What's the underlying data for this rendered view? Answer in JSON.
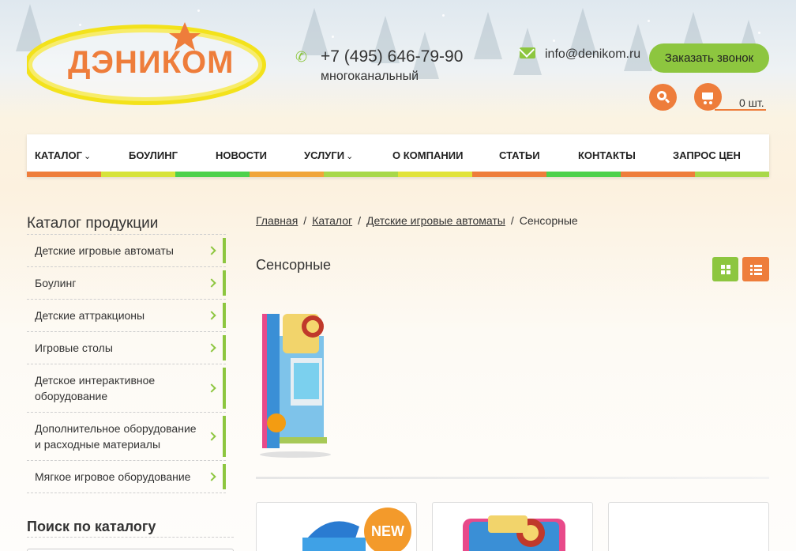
{
  "header": {
    "logo_text": "ДЭНИКОМ",
    "phone": "+7 (495) 646-79-90",
    "phone_note": "многоканальный",
    "email": "info@denikom.ru",
    "call_button": "Заказать звонок",
    "cart_count": "0 шт."
  },
  "nav": {
    "items": [
      {
        "label": "КАТАЛОГ",
        "has_dropdown": true
      },
      {
        "label": "БОУЛИНГ",
        "has_dropdown": false
      },
      {
        "label": "НОВОСТИ",
        "has_dropdown": false
      },
      {
        "label": "УСЛУГИ",
        "has_dropdown": true
      },
      {
        "label": "О КОМПАНИИ",
        "has_dropdown": false
      },
      {
        "label": "СТАТЬИ",
        "has_dropdown": false
      },
      {
        "label": "КОНТАКТЫ",
        "has_dropdown": false
      },
      {
        "label": "ЗАПРОС ЦЕН",
        "has_dropdown": false
      }
    ],
    "caret": "⌄",
    "stripe_colors": [
      "#ee7d3b",
      "#d7e33a",
      "#4ed14b",
      "#f0a53a",
      "#a8d84a",
      "#e1e33a",
      "#ee7d3b",
      "#4ed14b",
      "#ee7d3b",
      "#a8d84a"
    ]
  },
  "sidebar": {
    "title": "Каталог продукции",
    "items": [
      {
        "label": "Детские игровые автоматы"
      },
      {
        "label": "Боулинг"
      },
      {
        "label": "Детские аттракционы"
      },
      {
        "label": "Игровые столы"
      },
      {
        "label": "Детское интерактивное оборудование"
      },
      {
        "label": "Дополнительное оборудование и расходные материалы"
      },
      {
        "label": "Мягкое игровое оборудование"
      }
    ],
    "search_title": "Поиск по каталогу"
  },
  "breadcrumb": {
    "items": [
      "Главная",
      "Каталог",
      "Детские игровые автоматы"
    ],
    "current": "Сенсорные",
    "separator": "/"
  },
  "main": {
    "title": "Сенсорные",
    "badge_new": "NEW"
  },
  "colors": {
    "accent_green": "#8dc63f",
    "accent_orange": "#ee7d3b"
  }
}
